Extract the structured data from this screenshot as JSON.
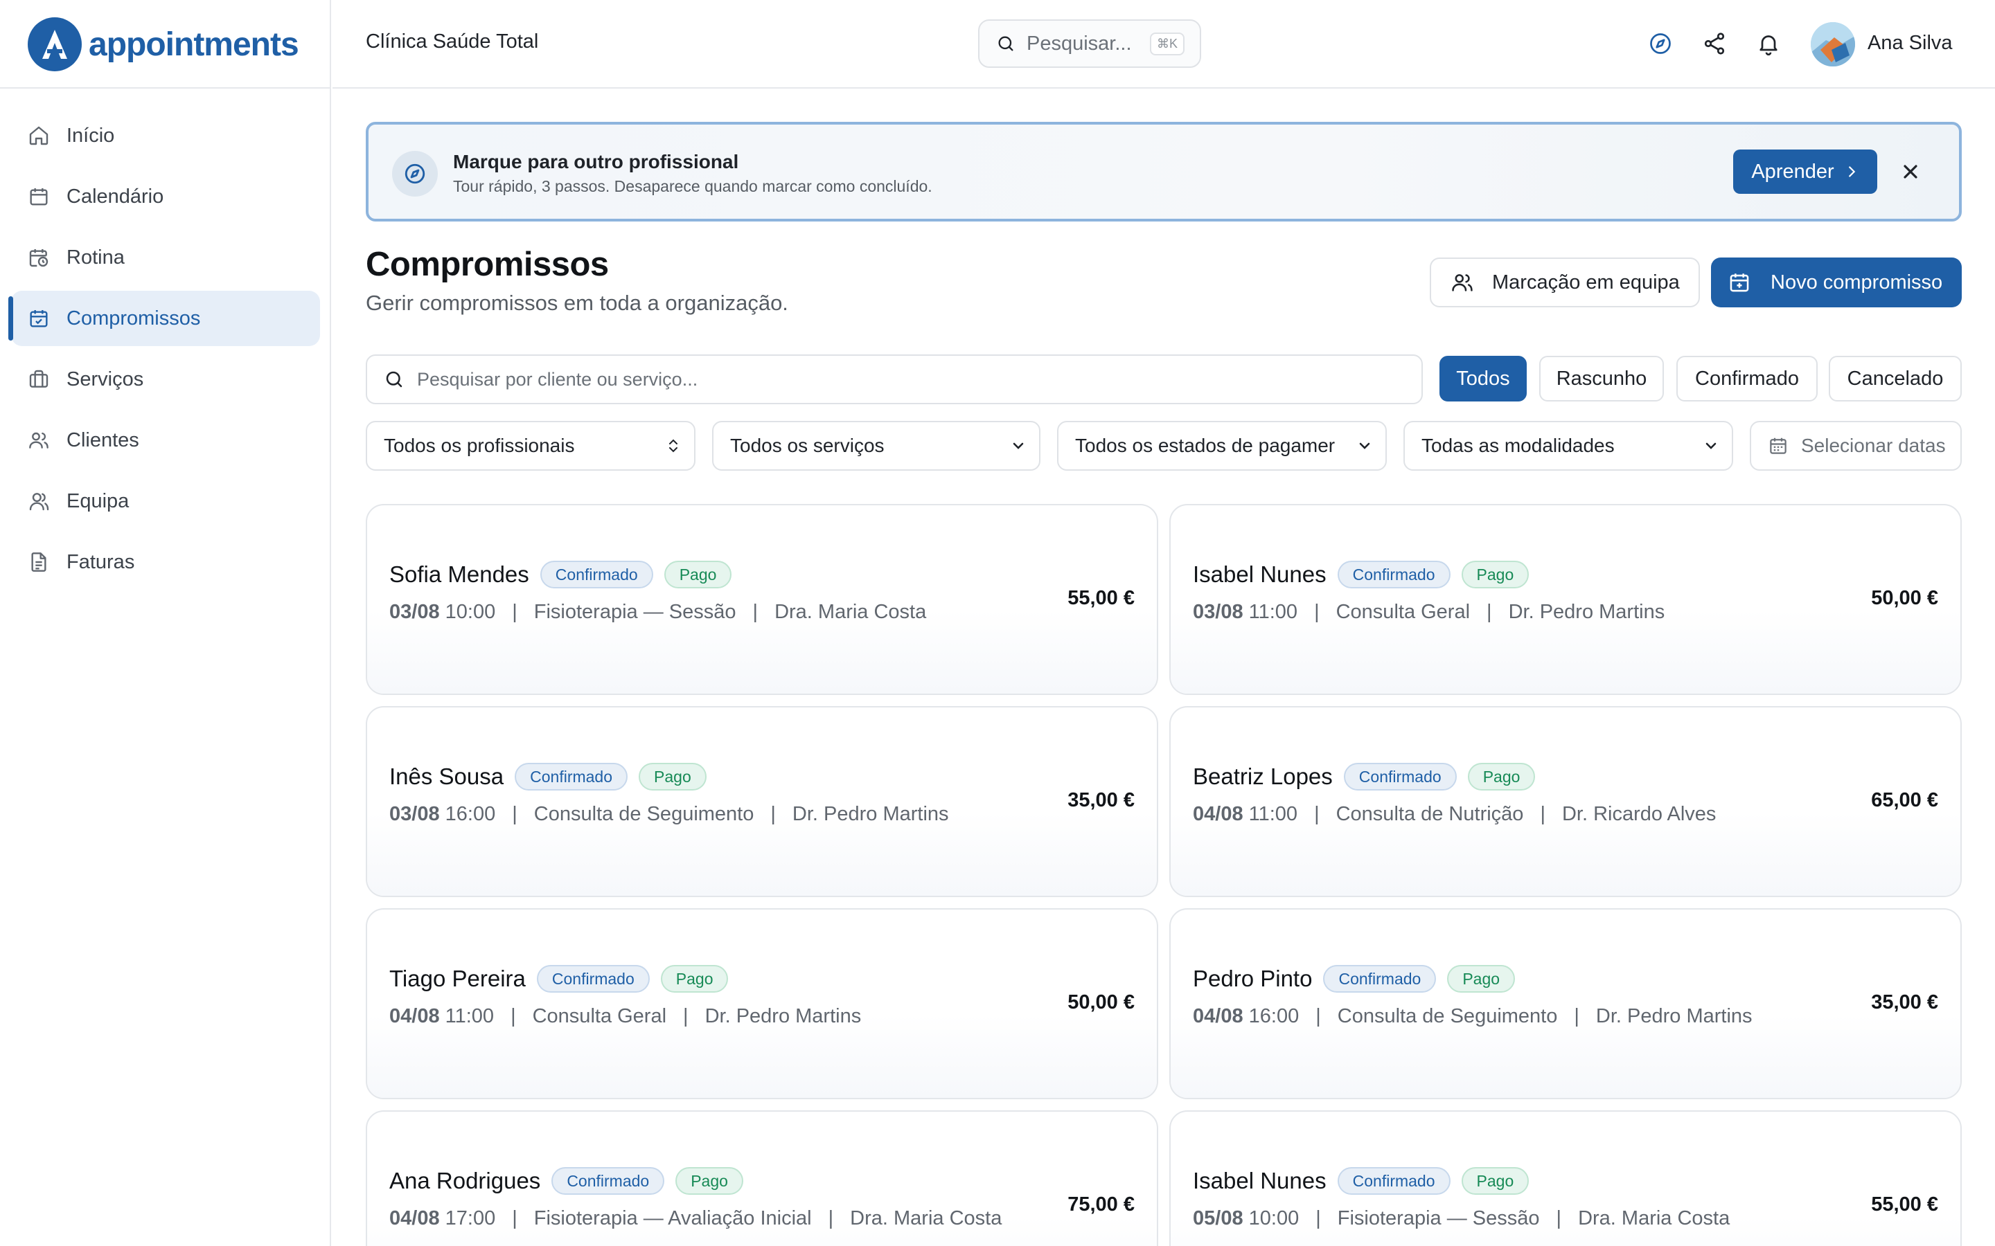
{
  "brand": {
    "logo_text": "appointments"
  },
  "header": {
    "clinic_name": "Clínica Saúde Total",
    "search_placeholder": "Pesquisar...",
    "search_shortcut": "⌘K",
    "user_name": "Ana Silva"
  },
  "sidebar": {
    "items": [
      {
        "label": "Início",
        "icon": "home-icon"
      },
      {
        "label": "Calendário",
        "icon": "calendar-icon"
      },
      {
        "label": "Rotina",
        "icon": "calendar-clock-icon"
      },
      {
        "label": "Compromissos",
        "icon": "calendar-check-icon",
        "active": true
      },
      {
        "label": "Serviços",
        "icon": "briefcase-icon"
      },
      {
        "label": "Clientes",
        "icon": "users-icon"
      },
      {
        "label": "Equipa",
        "icon": "team-icon"
      },
      {
        "label": "Faturas",
        "icon": "document-icon"
      }
    ]
  },
  "banner": {
    "title": "Marque para outro profissional",
    "subtitle": "Tour rápido, 3 passos. Desaparece quando marcar como concluído.",
    "learn_label": "Aprender"
  },
  "page": {
    "title": "Compromissos",
    "subtitle": "Gerir compromissos em toda a organização.",
    "team_button": "Marcação em equipa",
    "new_button": "Novo compromisso"
  },
  "filters": {
    "search_placeholder": "Pesquisar por cliente ou serviço...",
    "status_chips": [
      "Todos",
      "Rascunho",
      "Confirmado",
      "Cancelado"
    ],
    "active_chip": "Todos",
    "professionals": "Todos os profissionais",
    "services": "Todos os serviços",
    "payment_states": "Todos os estados de pagamer",
    "modalities": "Todas as modalidades",
    "dates_placeholder": "Selecionar datas"
  },
  "appointments": [
    {
      "client": "Sofia Mendes",
      "status": "Confirmado",
      "payment": "Pago",
      "date": "03/08",
      "time": "10:00",
      "service": "Fisioterapia — Sessão",
      "professional": "Dra. Maria Costa",
      "price": "55,00 €"
    },
    {
      "client": "Isabel Nunes",
      "status": "Confirmado",
      "payment": "Pago",
      "date": "03/08",
      "time": "11:00",
      "service": "Consulta Geral",
      "professional": "Dr. Pedro Martins",
      "price": "50,00 €"
    },
    {
      "client": "Inês Sousa",
      "status": "Confirmado",
      "payment": "Pago",
      "date": "03/08",
      "time": "16:00",
      "service": "Consulta de Seguimento",
      "professional": "Dr. Pedro Martins",
      "price": "35,00 €"
    },
    {
      "client": "Beatriz Lopes",
      "status": "Confirmado",
      "payment": "Pago",
      "date": "04/08",
      "time": "11:00",
      "service": "Consulta de Nutrição",
      "professional": "Dr. Ricardo Alves",
      "price": "65,00 €"
    },
    {
      "client": "Tiago Pereira",
      "status": "Confirmado",
      "payment": "Pago",
      "date": "04/08",
      "time": "11:00",
      "service": "Consulta Geral",
      "professional": "Dr. Pedro Martins",
      "price": "50,00 €"
    },
    {
      "client": "Pedro Pinto",
      "status": "Confirmado",
      "payment": "Pago",
      "date": "04/08",
      "time": "16:00",
      "service": "Consulta de Seguimento",
      "professional": "Dr. Pedro Martins",
      "price": "35,00 €"
    },
    {
      "client": "Ana Rodrigues",
      "status": "Confirmado",
      "payment": "Pago",
      "date": "04/08",
      "time": "17:00",
      "service": "Fisioterapia — Avaliação Inicial",
      "professional": "Dra. Maria Costa",
      "price": "75,00 €"
    },
    {
      "client": "Isabel Nunes",
      "status": "Confirmado",
      "payment": "Pago",
      "date": "05/08",
      "time": "10:00",
      "service": "Fisioterapia — Sessão",
      "professional": "Dra. Maria Costa",
      "price": "55,00 €"
    }
  ],
  "colors": {
    "brand": "#1f5fa6",
    "confirmed_badge": "#1f5fa6",
    "paid_badge": "#178a56",
    "active_nav_bg": "#e6eef8"
  }
}
